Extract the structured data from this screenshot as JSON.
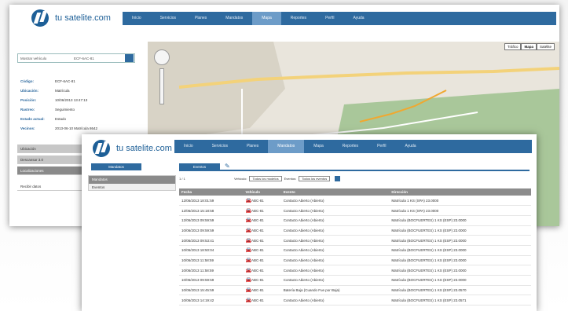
{
  "colors": {
    "brand": "#2e6a9f",
    "nav_active": "#6d9cc8",
    "header_row": "#8c8c8c"
  },
  "back_window": {
    "logo_text": "tu satelite.com",
    "nav": [
      "Inicio",
      "Servicios",
      "Planes",
      "Mandatos",
      "Mapa",
      "Reportes",
      "Perfil",
      "Ayuda"
    ],
    "nav_active_index": 4,
    "search": {
      "field1": "Mostrar vehículo",
      "field2": "ECF-6AC-81"
    },
    "info": [
      {
        "k": "Código:",
        "v": "ECF-6AC-81"
      },
      {
        "k": "Ubicación:",
        "v": "Matrícula"
      },
      {
        "k": "Posición:",
        "v": "10/06/2013 13:47:13"
      },
      {
        "k": "Rastreo:",
        "v": "Seguimiento"
      },
      {
        "k": "Estado actual:",
        "v": "Estado"
      },
      {
        "k": "Vecinos:",
        "v": "2013-06-10 Matrícula 8642"
      }
    ],
    "accordion": [
      "Ubicación",
      "Descansar 3.0",
      "Localizaciones",
      "Recibir datos"
    ],
    "map_types": [
      "Tráfico",
      "Mapa",
      "Satélite"
    ],
    "map_active_type": 1
  },
  "front_window": {
    "logo_text": "tu satelite.com",
    "nav": [
      "Inicio",
      "Servicios",
      "Planes",
      "Mandatos",
      "Mapa",
      "Reportes",
      "Perfil",
      "Ayuda"
    ],
    "nav_active_index": 3,
    "side_button": "Mandatos",
    "side_items": [
      "Mandatos",
      "Eventos"
    ],
    "tab": "Eventos",
    "filters": {
      "page": "1 / 1",
      "label1": "Vehículo:",
      "sel1": "Todos los modelos",
      "label2": "Eventos:",
      "sel2": "Todos los eventos"
    },
    "columns": [
      "Fecha",
      "Vehículo",
      "Evento",
      "Dirección"
    ],
    "rows": [
      [
        "12/06/2013 18:01:59",
        "ABC-81",
        "Contacto Abierto (Abierto)",
        "Matrícula 1 KS (SPA) 23.0000"
      ],
      [
        "12/06/2013 15:18:58",
        "ABC-81",
        "Contacto Abierto (Abierto)",
        "Matrícula 1 KS (SPA) 23.0000"
      ],
      [
        "12/06/2013 09:59:59",
        "ABC-81",
        "Contacto Abierto (Abierto)",
        "Matrícula (BOCFUERTES) 1 KS (ESP) 23.0000"
      ],
      [
        "10/06/2013 09:59:59",
        "ABC-81",
        "Contacto Abierto (Abierto)",
        "Matrícula (BOCFUERTES) 1 KS (ESP) 23.0000"
      ],
      [
        "10/06/2013 09:53:41",
        "ABC-81",
        "Contacto Abierto (Abierto)",
        "Matrícula (BOCFUERTES) 1 KS (ESP) 23.0000"
      ],
      [
        "10/06/2013 18:50:04",
        "ABC-81",
        "Contacto Abierto (Abierto)",
        "Matrícula (BOCFUERTES) 1 KS (ESP) 23.0000"
      ],
      [
        "10/06/2013 11:58:59",
        "ABC-81",
        "Contacto Abierto (Abierto)",
        "Matrícula (BOCFUERTES) 1 KS (ESP) 23.0000"
      ],
      [
        "10/06/2013 11:58:59",
        "ABC-81",
        "Contacto Abierto (Abierto)",
        "Matrícula (BOCFUERTES) 1 KS (ESP) 23.0000"
      ],
      [
        "10/06/2013 09:59:59",
        "ABC-81",
        "Contacto Abierto (Abierto)",
        "Matrícula (BOCFUERTES) 1 KS (ESP) 23.0000"
      ],
      [
        "10/06/2013 15:45:59",
        "ABC-81",
        "Batería Baja (Cuando Fue por Baja)",
        "Matrícula (BOCFUERTES) 1 KS (ESP) 23.0570"
      ],
      [
        "10/06/2013 14:19:42",
        "ABC-81",
        "Contacto Abierto (Abierto)",
        "Matrícula (BOCFUERTES) 1 KS (ESP) 23.0571"
      ]
    ]
  }
}
